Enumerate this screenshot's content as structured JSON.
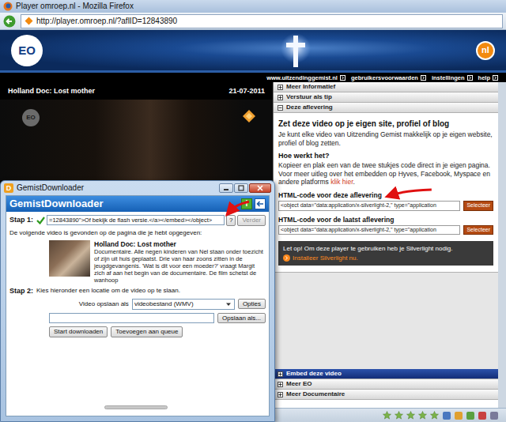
{
  "browser": {
    "title": "Player omroep.nl - Mozilla Firefox",
    "url": "http://player.omroep.nl/?aflID=12843890"
  },
  "player": {
    "logo": "EO",
    "region_badge": "nl",
    "menu": [
      "www.uitzendinggemist.nl",
      "gebruikersvoorwaarden",
      "instellingen",
      "help"
    ],
    "video": {
      "title": "Holland Doc: Lost mother",
      "date": "21-07-2011",
      "watermark": "EO"
    }
  },
  "panel": {
    "sections": [
      {
        "label": "Meer Informatief",
        "expanded": false
      },
      {
        "label": "Verstuur als tip",
        "expanded": false
      },
      {
        "label": "Deze aflevering",
        "expanded": true
      }
    ],
    "embed": {
      "heading": "Zet deze video op je eigen site, profiel of blog",
      "intro": "Je kunt elke video van Uitzending Gemist makkelijk op je eigen website, profiel of blog zetten.",
      "how_heading": "Hoe werkt het?",
      "how_text": "Kopieer en plak een van de twee stukjes code direct in je eigen pagina. Voor meer uitleg over het embedden op Hyves, Facebook, Myspace en andere platforms ",
      "how_link": "klik hier",
      "how_end": ".",
      "codes": [
        {
          "label": "HTML-code voor deze aflevering",
          "value": "<object data=\"data:application/x-silverlight-2,\" type=\"application",
          "button": "Selecteer"
        },
        {
          "label": "HTML-code voor de laatst aflevering",
          "value": "<object data=\"data:application/x-silverlight-2,\" type=\"application",
          "button": "Selecteer"
        }
      ],
      "notice": "Let op! Om deze player te gebruiken heb je Silverlight nodig.",
      "install_link": "Installeer Silverlight nu."
    },
    "bottom_sections": [
      {
        "label": "Embed deze video",
        "selected": true
      },
      {
        "label": "Meer EO",
        "selected": false
      },
      {
        "label": "Meer Documentaire",
        "selected": false
      }
    ]
  },
  "status_bar": {
    "stars": 5
  },
  "downloader": {
    "title": "GemistDownloader",
    "app_icon": "D",
    "header": "GemistDownloader",
    "info_button": "i",
    "step1": {
      "label": "Stap 1:",
      "done": true,
      "input": "=12843890\">Of bekijk de flash versie.</a></embed></object>",
      "help_button": "?",
      "next_button": "Verder",
      "next_disabled": true
    },
    "found_text": "De volgende video is gevonden op de pagina die je hebt opgegeven:",
    "video": {
      "title": "Holland Doc: Lost mother",
      "description": "Documentaire. Alle negen kinderen van Nel staan onder toezicht of zijn uit huis geplaatst. Drie van haar zoons zitten in de jeugdgevangenis. 'Wat is dit voor een moeder?' vraagt Margit zich af aan het begin van de documentaire. De film schetst de wanhoop"
    },
    "step2": {
      "label": "Stap 2:",
      "text": "Kies hieronder een locatie om de video op te slaan.",
      "save_as_label": "Video opslaan als",
      "format": "videobestand (WMV)",
      "options_button": "Opties",
      "browse_button": "Opslaan als..."
    },
    "buttons": [
      "Start downloaden",
      "Toevoegen aan queue"
    ]
  }
}
